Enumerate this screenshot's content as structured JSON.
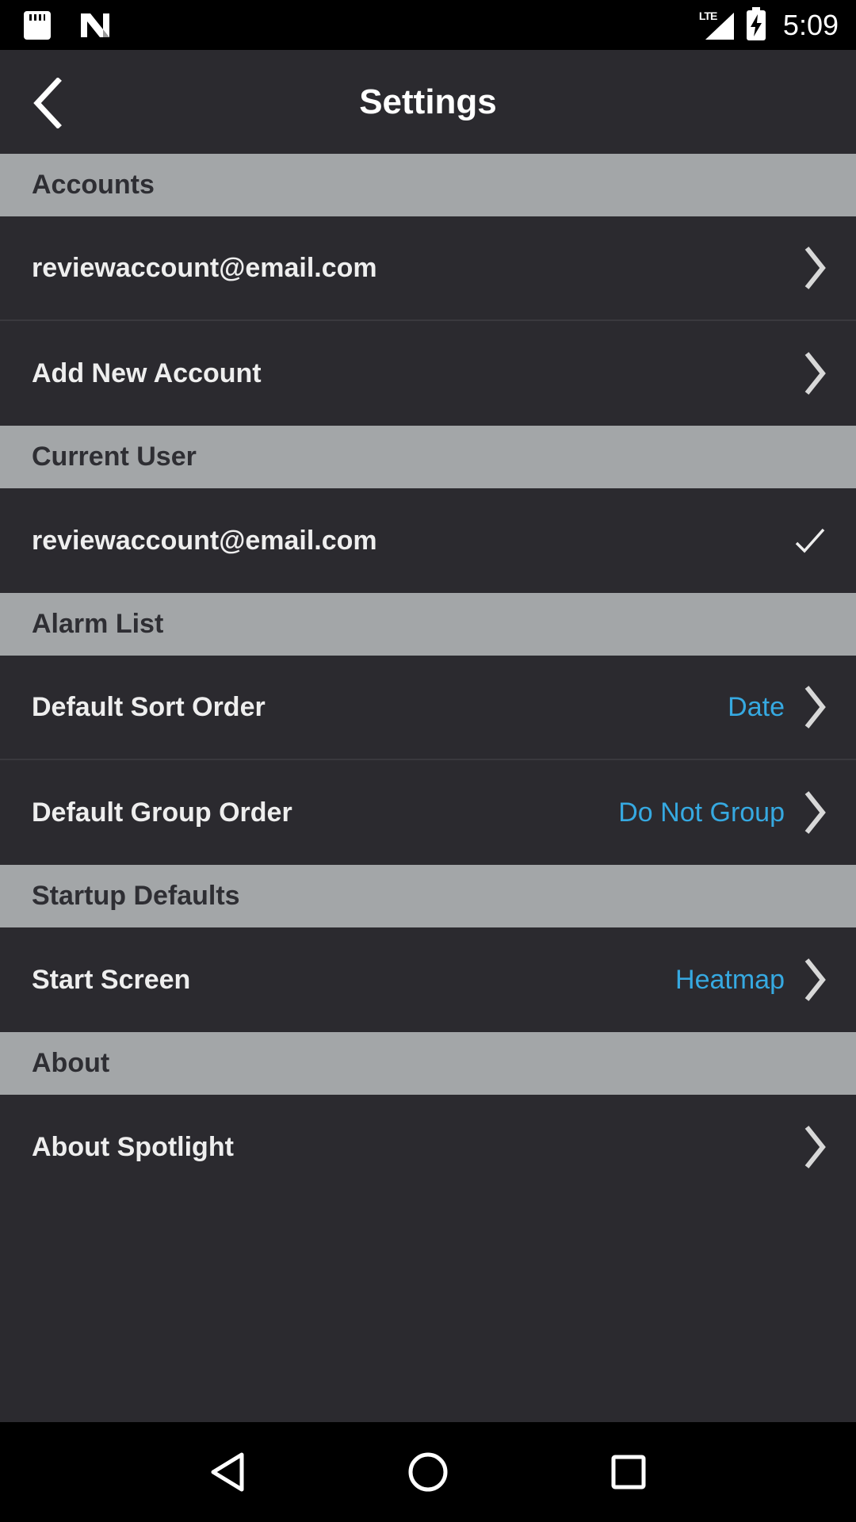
{
  "status_bar": {
    "time": "5:09",
    "network": "LTE",
    "icons": [
      "sd-card-icon",
      "n-icon",
      "signal-icon",
      "battery-charging-icon"
    ]
  },
  "app_bar": {
    "title": "Settings",
    "back_icon": "back-arrow-icon"
  },
  "sections": {
    "accounts": {
      "header": "Accounts",
      "items": [
        {
          "label": "reviewaccount@email.com"
        },
        {
          "label": "Add New Account"
        }
      ]
    },
    "current_user": {
      "header": "Current User",
      "items": [
        {
          "label": "reviewaccount@email.com",
          "selected": true
        }
      ]
    },
    "alarm_list": {
      "header": "Alarm List",
      "items": [
        {
          "label": "Default Sort Order",
          "value": "Date"
        },
        {
          "label": "Default Group Order",
          "value": "Do Not Group"
        }
      ]
    },
    "startup_defaults": {
      "header": "Startup Defaults",
      "items": [
        {
          "label": "Start Screen",
          "value": "Heatmap"
        }
      ]
    },
    "about": {
      "header": "About",
      "items": [
        {
          "label": "About Spotlight"
        }
      ]
    }
  },
  "nav_bar": {
    "icons": [
      "nav-back-icon",
      "nav-home-icon",
      "nav-recents-icon"
    ]
  },
  "colors": {
    "background": "#2b2a2f",
    "section_header": "#a3a6a8",
    "accent_value": "#36a9e1",
    "bars": "#000000"
  }
}
